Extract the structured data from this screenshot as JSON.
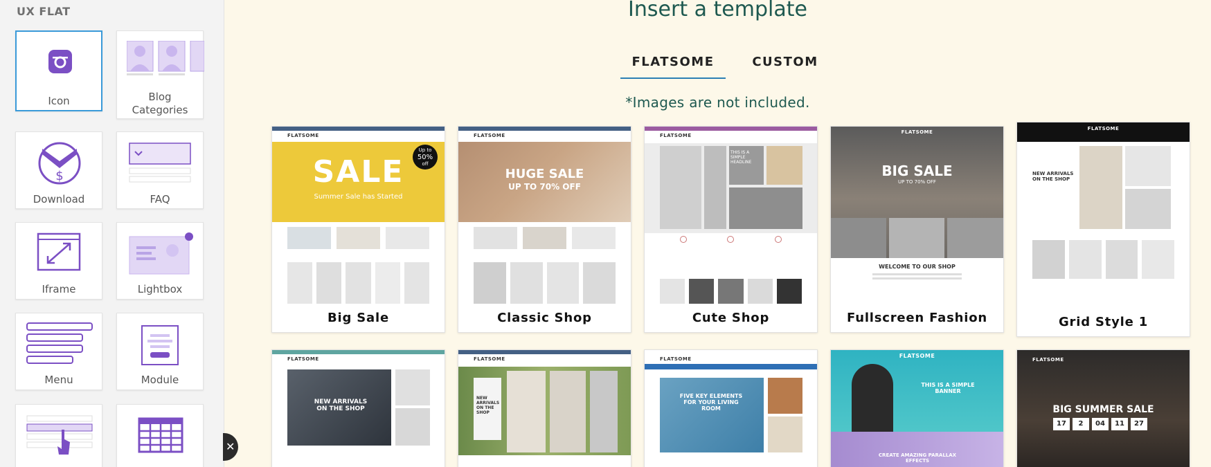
{
  "panel": {
    "title": "UX FLAT",
    "items": [
      {
        "label": "Icon"
      },
      {
        "label": "Blog Categories"
      },
      {
        "label": "Download"
      },
      {
        "label": "FAQ"
      },
      {
        "label": "Iframe"
      },
      {
        "label": "Lightbox"
      },
      {
        "label": "Menu"
      },
      {
        "label": "Module"
      }
    ]
  },
  "main": {
    "title": "Insert a template",
    "tabs": [
      {
        "label": "FLATSOME",
        "active": true
      },
      {
        "label": "CUSTOM",
        "active": false
      }
    ],
    "note": "*Images are not included.",
    "templates": [
      {
        "name": "Big Sale",
        "hero_text": "SALE",
        "hero_sub": "Summer Sale has Started",
        "badge_1": "Up to",
        "badge_2": "50%",
        "badge_3": "off"
      },
      {
        "name": "Classic Shop",
        "hero_text": "HUGE SALE",
        "hero_sub": "UP TO 70% OFF"
      },
      {
        "name": "Cute Shop",
        "hero_text": "THIS IS A SIMPLE HEADLINE"
      },
      {
        "name": "Fullscreen Fashion",
        "hero_text": "BIG SALE",
        "hero_sub": "UP TO 70% OFF",
        "welcome": "WELCOME TO OUR SHOP"
      },
      {
        "name": "Grid Style 1",
        "hero_text": "NEW ARRIVALS ON THE SHOP"
      }
    ],
    "bottom_templates": [
      {
        "hero_text": "NEW ARRIVALS ON THE SHOP"
      },
      {
        "hero_text": "NEW ARRIVALS ON THE SHOP"
      },
      {
        "hero_text": "FIVE KEY ELEMENTS FOR YOUR LIVING ROOM"
      },
      {
        "hero_text": "THIS IS A SIMPLE BANNER",
        "hero_sub": "CREATE AMAZING PARALLAX EFFECTS"
      },
      {
        "hero_text": "BIG SUMMER SALE",
        "countdown": [
          "17",
          "2",
          "04",
          "11",
          "27"
        ]
      }
    ],
    "logo_text": "FLATSOME"
  },
  "colors": {
    "accent": "#7b4fc4",
    "heading": "#1e5950",
    "tab_underline": "#2b7fb5",
    "active_border": "#3a9ad9",
    "page_bg": "#fdf8e9"
  }
}
